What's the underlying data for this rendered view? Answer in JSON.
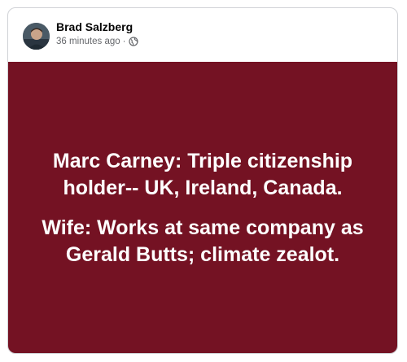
{
  "post": {
    "author": "Brad Salzberg",
    "timestamp": "36 minutes ago",
    "separator": "·",
    "privacy_icon": "globe-icon",
    "background_color": "#741223",
    "text_color": "#ffffff",
    "paragraphs": [
      "Marc Carney: Triple citizenship holder-- UK, Ireland, Canada.",
      "Wife: Works at same company as Gerald Butts; climate zealot."
    ]
  }
}
